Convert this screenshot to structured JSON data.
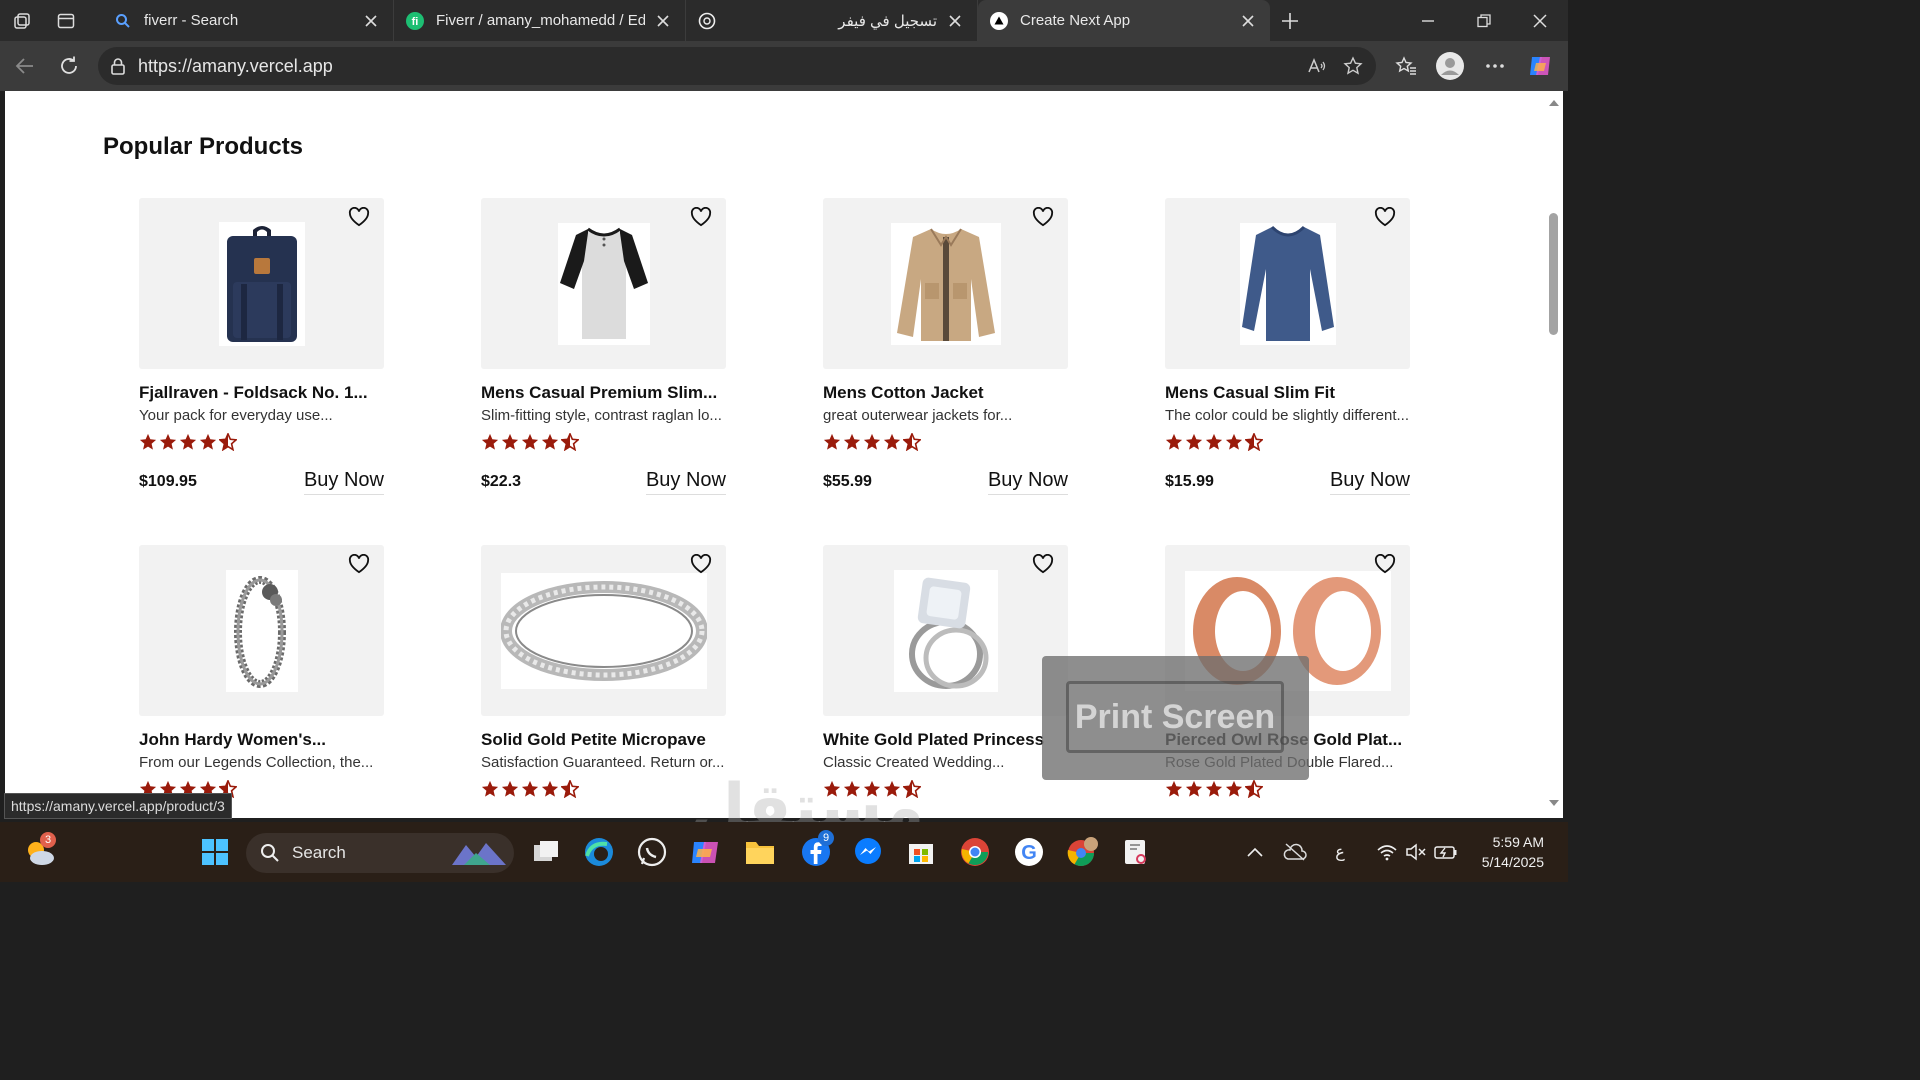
{
  "browser": {
    "tabs": [
      {
        "title": "fiverr - Search",
        "icon": "search-icon"
      },
      {
        "title": "Fiverr / amany_mohamedd / Edit",
        "icon": "fiverr-icon"
      },
      {
        "title": "تسجيل في فيفر",
        "icon": "chatgpt-icon"
      },
      {
        "title": "Create Next App",
        "icon": "vercel-icon",
        "active": true
      }
    ],
    "address": "https://amany.vercel.app",
    "status_url": "https://amany.vercel.app/product/3"
  },
  "page": {
    "heading": "Popular Products",
    "buy_label": "Buy Now",
    "rating_stars": 4.5,
    "products": [
      {
        "name": "Fjallraven - Foldsack No. 1...",
        "desc": "Your pack for everyday use...",
        "price": "$109.95",
        "img": "backpack"
      },
      {
        "name": "Mens Casual Premium Slim...",
        "desc": "Slim-fitting style, contrast raglan lo...",
        "price": "$22.3",
        "img": "tshirt"
      },
      {
        "name": "Mens Cotton Jacket",
        "desc": "great outerwear jackets for...",
        "price": "$55.99",
        "img": "jacket"
      },
      {
        "name": "Mens Casual Slim Fit",
        "desc": "The color could be slightly different...",
        "price": "$15.99",
        "img": "longsleeve"
      },
      {
        "name": "John Hardy Women's...",
        "desc": "From our Legends Collection, the...",
        "price": "",
        "img": "bracelet"
      },
      {
        "name": "Solid Gold Petite Micropave",
        "desc": "Satisfaction Guaranteed. Return or...",
        "price": "",
        "img": "ring-band"
      },
      {
        "name": "White Gold Plated Princess",
        "desc": "Classic Created Wedding...",
        "price": "",
        "img": "ring-diamond"
      },
      {
        "name": "Pierced Owl Rose Gold Plat...",
        "desc": "Rose Gold Plated Double Flared...",
        "price": "",
        "img": "plugs"
      }
    ]
  },
  "overlay": {
    "print_screen": "Print Screen",
    "watermark": "مستقل"
  },
  "taskbar": {
    "search_label": "Search",
    "weather_badge": "3",
    "facebook_badge": "9",
    "language": "ع",
    "time": "5:59 AM",
    "date": "5/14/2025"
  },
  "colors": {
    "star": "#9a1b0b",
    "accent": "#0b7bd6"
  }
}
